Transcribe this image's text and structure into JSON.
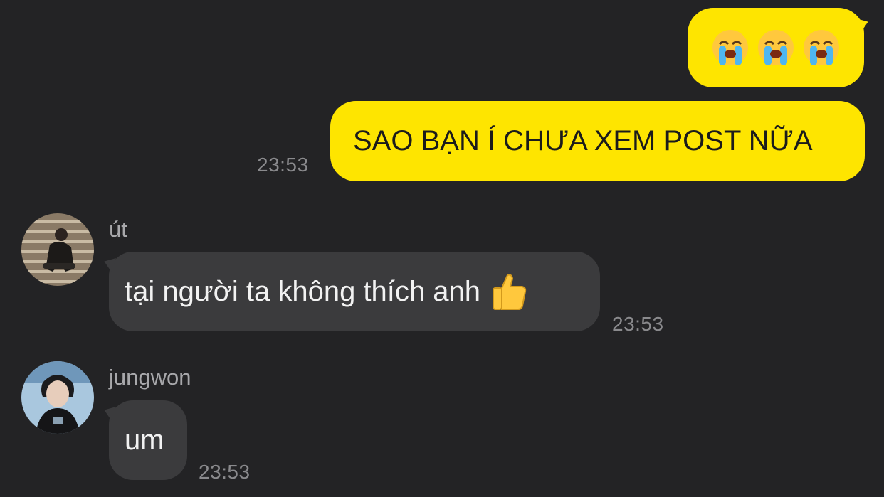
{
  "messages": [
    {
      "direction": "outgoing",
      "content_icons": [
        "loudly-crying-face-icon",
        "loudly-crying-face-icon",
        "loudly-crying-face-icon"
      ]
    },
    {
      "direction": "outgoing",
      "text": "SAO BẠN Í CHƯA XEM POST NỮA",
      "time": "23:53"
    },
    {
      "direction": "incoming",
      "sender": "út",
      "text": "tại người ta không thích anh",
      "trailing_icon": "thumbs-up-icon",
      "time": "23:53"
    },
    {
      "direction": "incoming",
      "sender": "jungwon",
      "text": "um",
      "time": "23:53"
    }
  ],
  "colors": {
    "background": "#232325",
    "outgoing_bubble": "#FEE500",
    "incoming_bubble": "#3b3b3d",
    "timestamp": "#8a8a8d"
  }
}
